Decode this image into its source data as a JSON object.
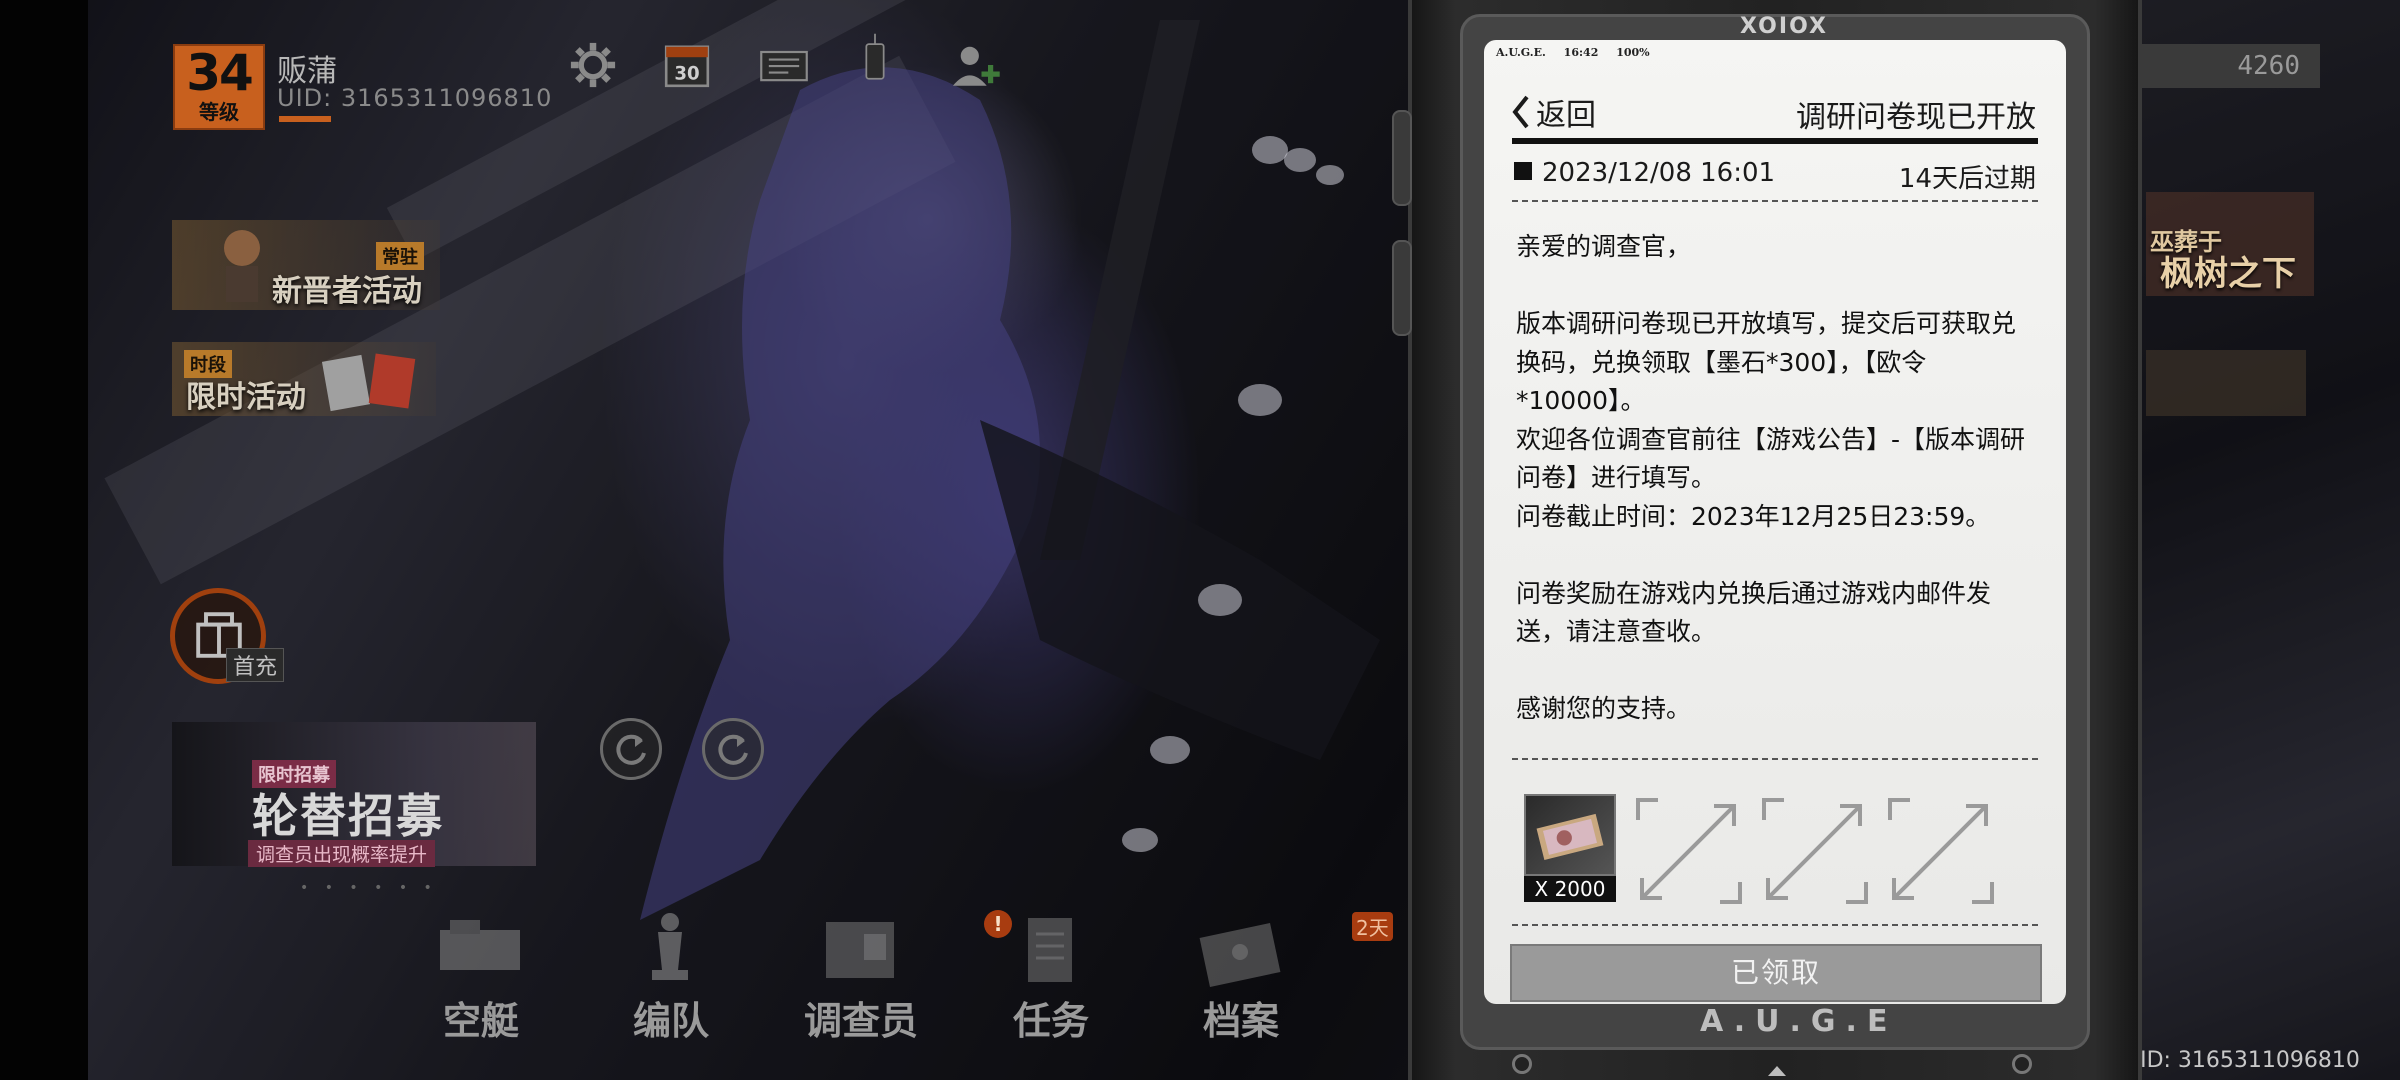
{
  "player": {
    "level": "34",
    "level_label": "等级",
    "name": "贩蒲",
    "uid": "UID: 3165311096810"
  },
  "top_icons": [
    "gear-icon",
    "calendar-icon",
    "mail-icon",
    "device-icon",
    "add-friend-icon"
  ],
  "calendar_day": "30",
  "currency": {
    "value": "4260"
  },
  "events": {
    "newcomer": {
      "tag": "常驻",
      "label": "新晋者活动"
    },
    "limited": {
      "tag": "时段",
      "label": "限时活动"
    },
    "first_charge": "首充",
    "recruit": {
      "tag": "限时招募",
      "title": "轮替招募",
      "subtitle": "调查员出现概率提升",
      "dots": "• • • • • •"
    }
  },
  "right_banners": [
    {
      "line1": "巫葬于",
      "line2": "枫树之下"
    }
  ],
  "nav": [
    {
      "key": "airship",
      "label": "空艇"
    },
    {
      "key": "team",
      "label": "编队"
    },
    {
      "key": "investigator",
      "label": "调查员"
    },
    {
      "key": "tasks",
      "label": "任务",
      "alert": "!"
    },
    {
      "key": "archive",
      "label": "档案"
    }
  ],
  "nav_badge": "2天",
  "uid_bottom": "UID: 3165311096810",
  "device": {
    "logo": "XOIOX",
    "brand": "A.U.G.E",
    "status": {
      "carrier": "A.U.G.E.",
      "time": "16:42",
      "battery": "100%"
    }
  },
  "mail": {
    "back_label": "返回",
    "title": "调研问卷现已开放",
    "date": "2023/12/08 16:01",
    "expire": "14天后过期",
    "body": [
      "亲爱的调查官，",
      "",
      "版本调研问卷现已开放填写，提交后可获取兑换码，兑换领取【墨石*300】，【欧令*10000】。",
      "欢迎各位调查官前往【游戏公告】-【版本调研问卷】进行填写。",
      "问卷截止时间：2023年12月25日23:59。",
      "",
      "问卷奖励在游戏内兑换后通过游戏内邮件发送，请注意查收。",
      "",
      "感谢您的支持。"
    ],
    "reward": {
      "count": "X 2000",
      "icon": "banknote-icon"
    },
    "claimed_slots": 3,
    "claim_button": "已领取"
  },
  "colors": {
    "accent_orange": "#c8601e",
    "screen_bg": "#f2f2f0",
    "button_disabled": "#9a9a9a"
  }
}
